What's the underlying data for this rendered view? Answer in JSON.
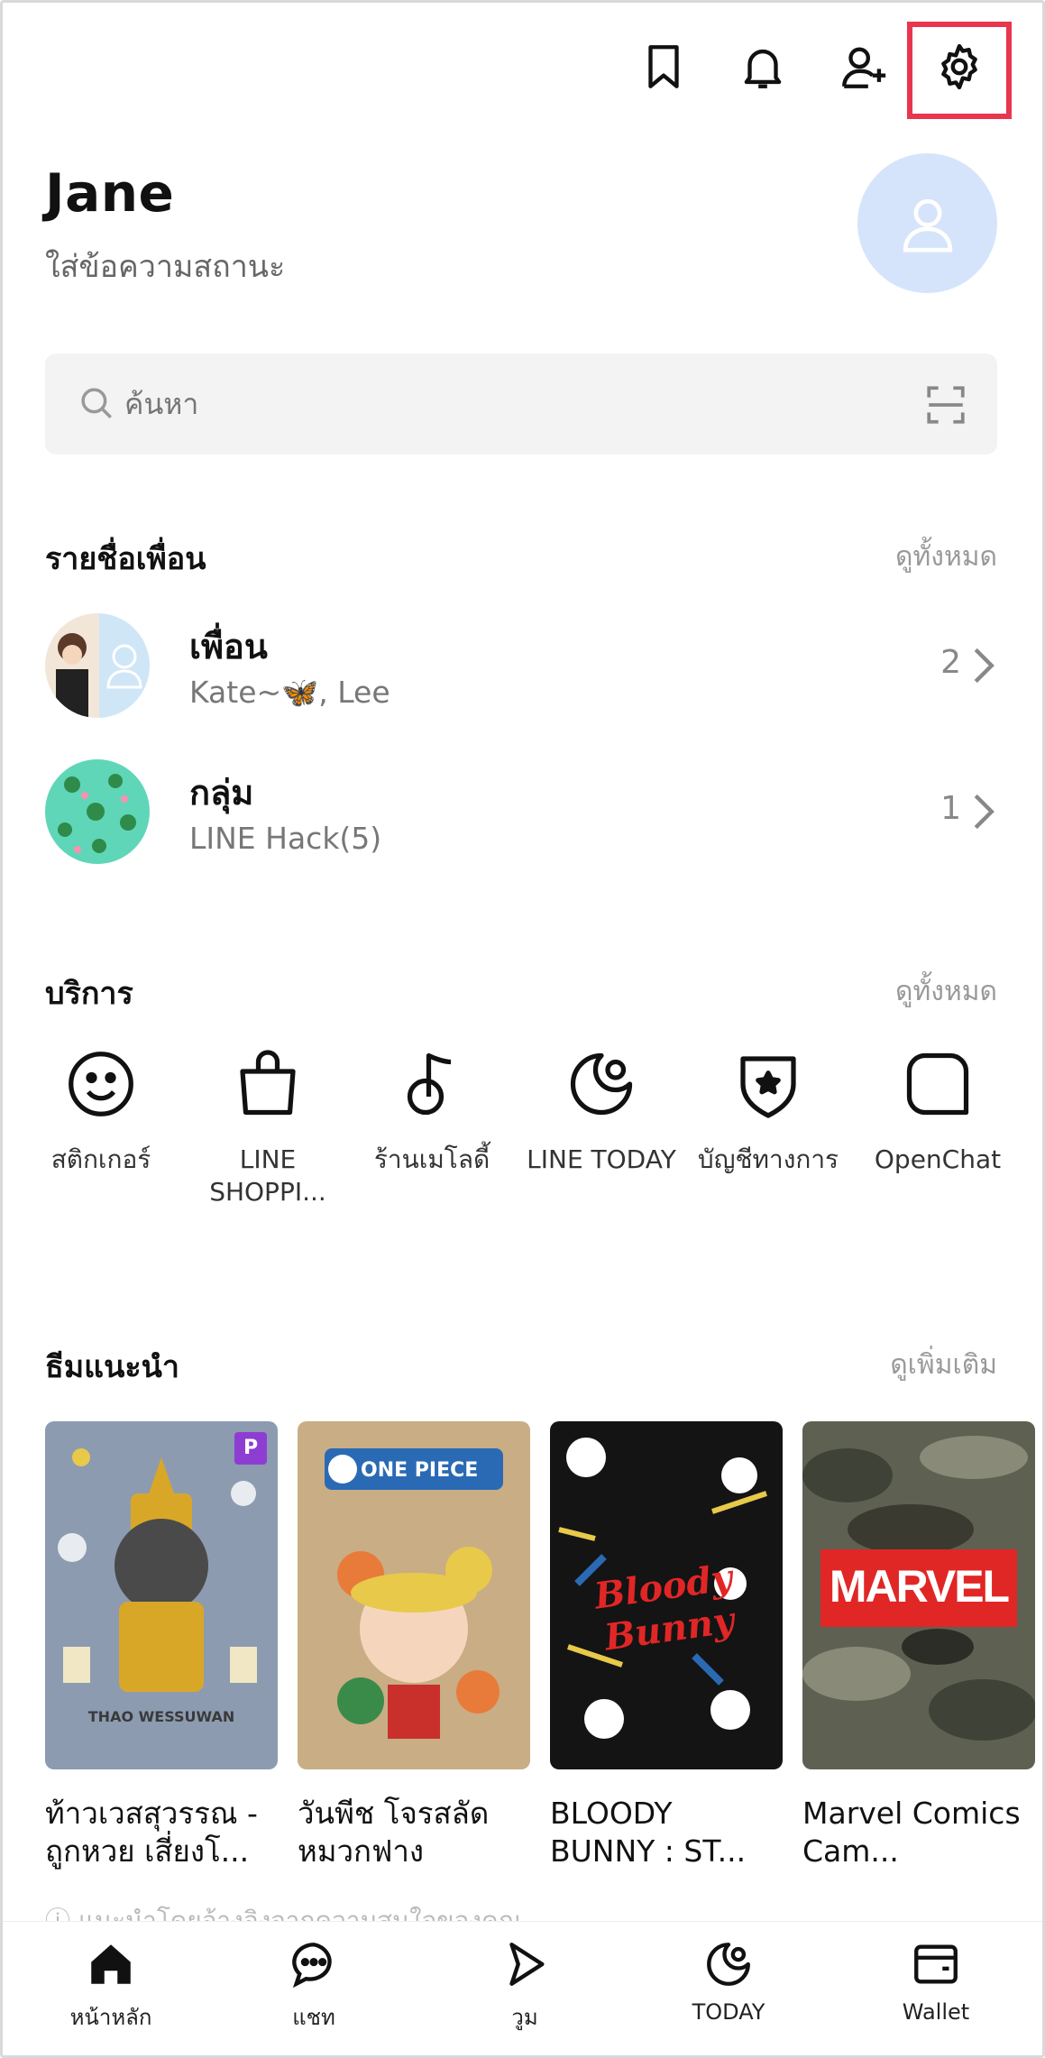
{
  "header": {
    "icons": [
      "bookmark-icon",
      "bell-icon",
      "add-friend-icon",
      "gear-icon"
    ],
    "highlight_color": "#e8364f"
  },
  "profile": {
    "name": "Jane",
    "status_placeholder": "ใส่ข้อความสถานะ",
    "avatar_color": "#d6e4fb"
  },
  "search": {
    "placeholder": "ค้นหา"
  },
  "friends_section": {
    "title": "รายชื่อเพื่อน",
    "see_all": "ดูทั้งหมด",
    "rows": [
      {
        "title": "เพื่อน",
        "subtitle": "Kate~🦋, Lee",
        "count": "2"
      },
      {
        "title": "กลุ่ม",
        "subtitle": "LINE Hack(5)",
        "count": "1"
      }
    ]
  },
  "services_section": {
    "title": "บริการ",
    "see_all": "ดูทั้งหมด",
    "items": [
      {
        "label": "สติกเกอร์",
        "icon": "smiley-icon"
      },
      {
        "label": "LINE SHOPPI...",
        "icon": "shopping-bag-icon"
      },
      {
        "label": "ร้านเมโลดี้",
        "icon": "music-note-icon"
      },
      {
        "label": "LINE TODAY",
        "icon": "today-icon"
      },
      {
        "label": "บัญชีทางการ",
        "icon": "shield-star-icon"
      },
      {
        "label": "OpenChat",
        "icon": "openchat-icon"
      }
    ]
  },
  "themes_section": {
    "title": "ธีมแนะนำ",
    "see_more": "ดูเพิ่มเติม",
    "items": [
      {
        "name": "ท้าวเวสสุวรรณ - ถูกหวย เสี่ยงโ...",
        "card_text": "THAO WESSUWAN",
        "badge": "P"
      },
      {
        "name": "วันพีช โจรสลัด หมวกฟาง",
        "card_text": "ONE PIECE"
      },
      {
        "name": "BLOODY BUNNY : ST...",
        "card_text": "Bloody Bunny"
      },
      {
        "name": "Marvel Comics Cam...",
        "card_text": "MARVEL"
      }
    ],
    "footer_note": "ⓘ แนะนำโดยอ้างอิงจากความสนใจของคุณ"
  },
  "bottom_nav": {
    "items": [
      {
        "label": "หน้าหลัก",
        "icon": "home-icon"
      },
      {
        "label": "แชท",
        "icon": "chat-icon"
      },
      {
        "label": "วูม",
        "icon": "voom-icon"
      },
      {
        "label": "TODAY",
        "icon": "today-icon"
      },
      {
        "label": "Wallet",
        "icon": "wallet-icon"
      }
    ]
  }
}
